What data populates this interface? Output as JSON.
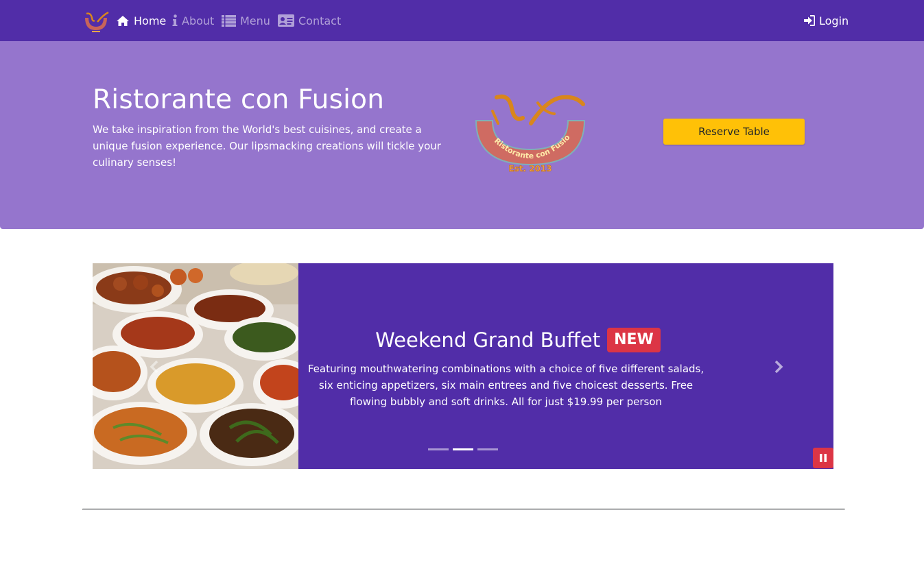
{
  "navbar": {
    "brand_alt": "Ristorante con Fusion",
    "items": [
      {
        "label": "Home",
        "icon": "home-icon",
        "active": true
      },
      {
        "label": "About",
        "icon": "info-icon",
        "active": false
      },
      {
        "label": "Menu",
        "icon": "list-icon",
        "active": false
      },
      {
        "label": "Contact",
        "icon": "address-card-icon",
        "active": false
      }
    ],
    "login_label": "Login",
    "login_icon": "sign-in-icon"
  },
  "jumbotron": {
    "title": "Ristorante con Fusion",
    "text": "We take inspiration from the World's best cuisines, and create a unique fusion experience. Our lipsmacking creations will tickle your culinary senses!",
    "logo_ring_text": "Ristorante con Fusion",
    "logo_est_text": "Est. 2013",
    "reserve_label": "Reserve Table"
  },
  "carousel": {
    "title": "Weekend Grand Buffet",
    "badge": "NEW",
    "text": "Featuring mouthwatering combinations with a choice of five different salads, six enticing appetizers, six main entrees and five choicest desserts. Free flowing bubbly and soft drinks. All for just $19.99 per person",
    "indicator_count": 3,
    "active_indicator": 1,
    "image_alt": "buffet dishes"
  },
  "colors": {
    "primary": "#512da8",
    "light": "#9575cd",
    "warning": "#ffc107",
    "danger": "#dc3545"
  }
}
